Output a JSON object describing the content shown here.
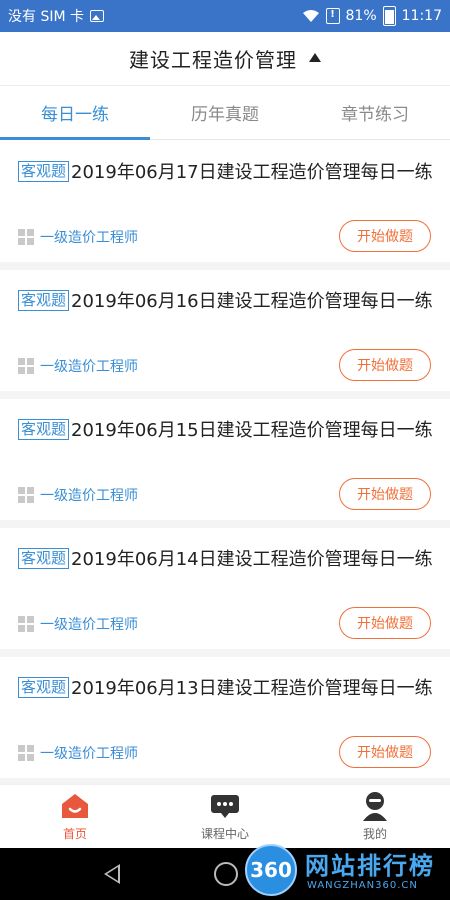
{
  "status_bar": {
    "carrier": "没有 SIM 卡",
    "battery": "81%",
    "time": "11:17"
  },
  "header": {
    "title": "建设工程造价管理"
  },
  "tabs": [
    {
      "label": "每日一练",
      "active": true
    },
    {
      "label": "历年真题",
      "active": false
    },
    {
      "label": "章节练习",
      "active": false
    }
  ],
  "items": [
    {
      "tag": "客观题",
      "title": "2019年06月17日建设工程造价管理每日一练",
      "category": "一级造价工程师",
      "button": "开始做题"
    },
    {
      "tag": "客观题",
      "title": "2019年06月16日建设工程造价管理每日一练",
      "category": "一级造价工程师",
      "button": "开始做题"
    },
    {
      "tag": "客观题",
      "title": "2019年06月15日建设工程造价管理每日一练",
      "category": "一级造价工程师",
      "button": "开始做题"
    },
    {
      "tag": "客观题",
      "title": "2019年06月14日建设工程造价管理每日一练",
      "category": "一级造价工程师",
      "button": "开始做题"
    },
    {
      "tag": "客观题",
      "title": "2019年06月13日建设工程造价管理每日一练",
      "category": "一级造价工程师",
      "button": "开始做题"
    }
  ],
  "bottom_nav": [
    {
      "label": "首页",
      "icon": "home-icon",
      "active": true
    },
    {
      "label": "课程中心",
      "icon": "chat-icon",
      "active": false
    },
    {
      "label": "我的",
      "icon": "user-icon",
      "active": false
    }
  ],
  "watermark": {
    "badge": "360",
    "title": "网站排行榜",
    "subtitle": "WANGZHAN360.CN"
  },
  "colors": {
    "status_bar": "#3a74c8",
    "accent_blue": "#3a8ed6",
    "accent_orange": "#f0703a",
    "nav_active": "#e8583c"
  }
}
